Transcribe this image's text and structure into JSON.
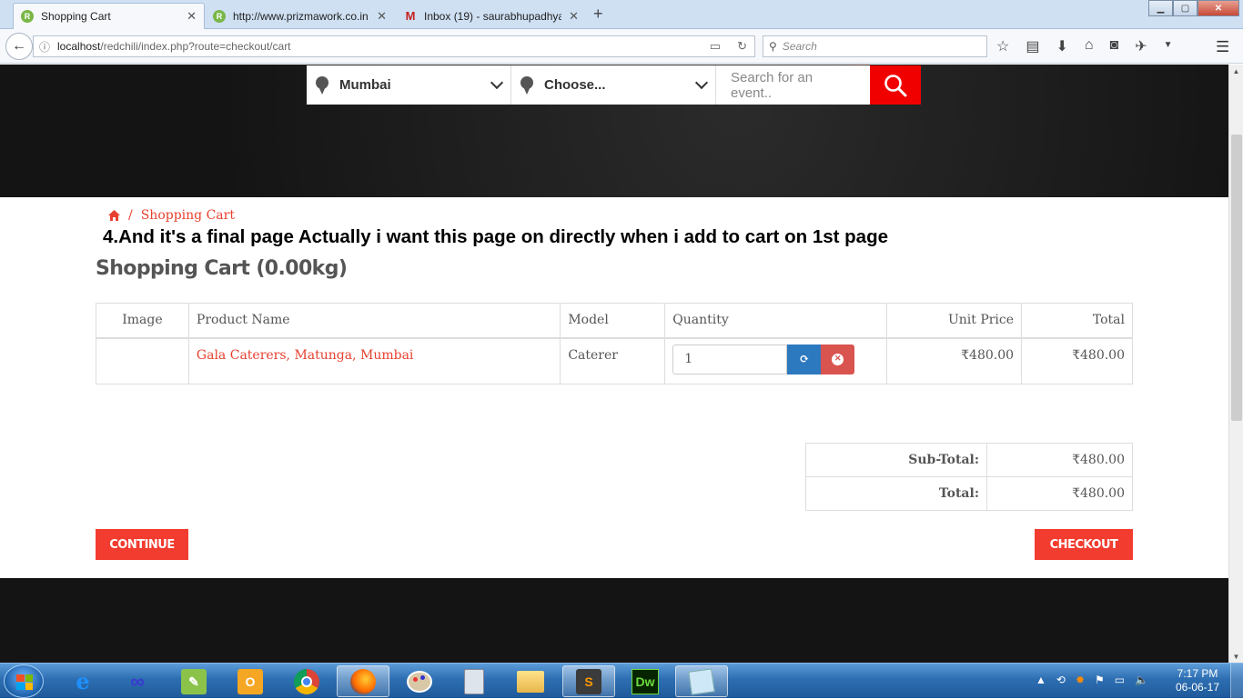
{
  "browser": {
    "tabs": [
      {
        "title": "Shopping Cart",
        "favicon": "R"
      },
      {
        "title": "http://www.prizmawork.co.in",
        "favicon": "R"
      },
      {
        "title": "Inbox (19) - saurabhupadhyay",
        "favicon": "M"
      }
    ],
    "new_tab": "+",
    "url_host": "localhost",
    "url_path": "/redchili/index.php?route=checkout/cart",
    "search_placeholder": "Search"
  },
  "search_form": {
    "city": "Mumbai",
    "category": "Choose...",
    "event_placeholder": "Search for an event.."
  },
  "breadcrumb": {
    "current": "Shopping Cart",
    "separator": "/"
  },
  "note": "4.And it's a final page Actually i want this page on directly when i add to cart on 1st page",
  "page_title": "Shopping Cart  (0.00kg)",
  "cart_table": {
    "headers": {
      "image": "Image",
      "product": "Product Name",
      "model": "Model",
      "quantity": "Quantity",
      "unit_price": "Unit Price",
      "total": "Total"
    },
    "rows": [
      {
        "product": "Gala Caterers, Matunga, Mumbai",
        "model": "Caterer",
        "quantity": "1",
        "unit_price": "₹480.00",
        "total": "₹480.00"
      }
    ]
  },
  "totals": {
    "subtotal_label": "Sub-Total:",
    "subtotal_value": "₹480.00",
    "total_label": "Total:",
    "total_value": "₹480.00"
  },
  "buttons": {
    "continue": "CONTINUE",
    "checkout": "CHECKOUT"
  },
  "taskbar": {
    "time": "7:17 PM",
    "date": "06-06-17"
  },
  "colors": {
    "accent": "#f23c2f",
    "link": "#e8402f",
    "search_button": "#f10000",
    "update_button": "#2d79c0",
    "remove_button": "#d9534f"
  }
}
